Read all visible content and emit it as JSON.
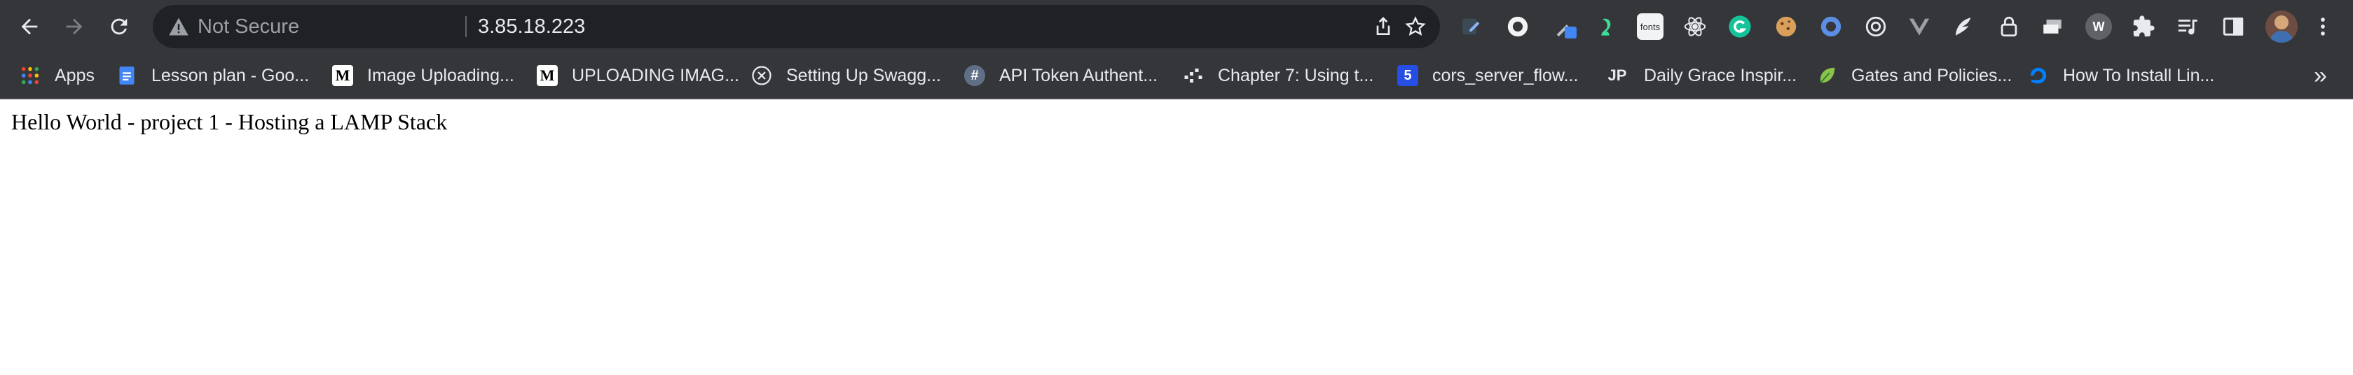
{
  "toolbar": {
    "back_icon": "arrow-left-icon",
    "forward_icon": "arrow-right-icon",
    "reload_icon": "reload-icon",
    "security_label": "Not Secure",
    "url": "3.85.18.223",
    "share_icon": "share-icon",
    "bookmark_star_icon": "star-icon"
  },
  "extensions": {
    "fonts_label": "fonts",
    "w_label": "W"
  },
  "bookmarks": {
    "items": [
      {
        "label": "Apps",
        "icon": "apps-grid-icon"
      },
      {
        "label": "Lesson plan - Goo...",
        "icon": "google-docs-icon"
      },
      {
        "label": "Image Uploading...",
        "icon": "medium-icon",
        "icon_text": "M"
      },
      {
        "label": "UPLOADING IMAG...",
        "icon": "medium-icon",
        "icon_text": "M"
      },
      {
        "label": "Setting Up Swagg...",
        "icon": "swagger-icon"
      },
      {
        "label": "API Token Authent...",
        "icon": "hash-icon",
        "icon_text": "#"
      },
      {
        "label": "Chapter 7: Using t...",
        "icon": "dots-icon"
      },
      {
        "label": "cors_server_flow...",
        "icon": "css-icon",
        "icon_text": "5"
      },
      {
        "label": "Daily Grace Inspir...",
        "icon": "jp-icon",
        "icon_text": "JP"
      },
      {
        "label": "Gates and Policies...",
        "icon": "leaf-icon"
      },
      {
        "label": "How To Install Lin...",
        "icon": "digitalocean-icon"
      }
    ],
    "overflow_label": "»"
  },
  "page": {
    "text": "Hello World - project 1 - Hosting a LAMP Stack"
  },
  "colors": {
    "chrome_bg": "#35363a",
    "omnibox_bg": "#202124",
    "text": "#e8eaed",
    "muted": "#9aa0a6",
    "page_bg": "#ffffff"
  }
}
